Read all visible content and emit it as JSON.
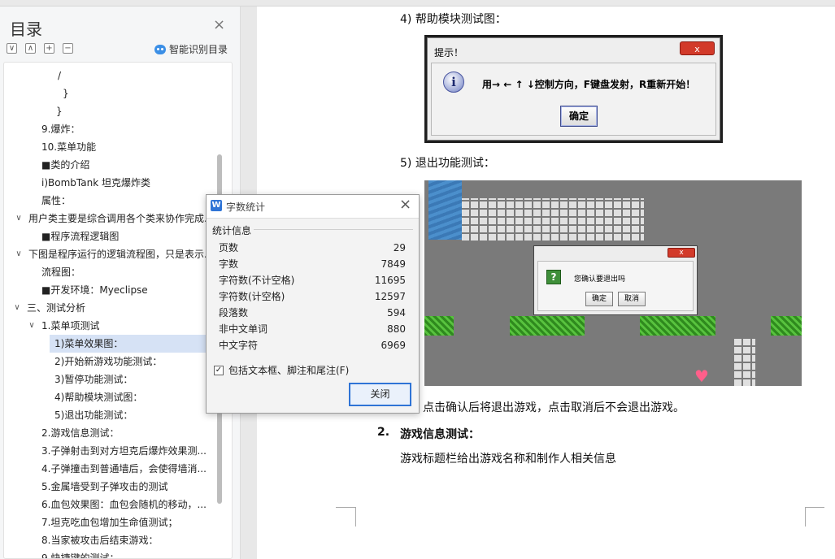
{
  "sidebar": {
    "title": "目录",
    "close_glyph": "×",
    "tools": [
      "∨",
      "∧",
      "+",
      "−"
    ],
    "smart_label": "智能识别目录",
    "items": [
      {
        "text": "/",
        "indent": 66,
        "caret": ""
      },
      {
        "text": "}",
        "indent": 72,
        "caret": ""
      },
      {
        "text": "}",
        "indent": 64,
        "caret": ""
      },
      {
        "text": "9.爆炸：",
        "indent": 46,
        "caret": ""
      },
      {
        "text": "10.菜单功能",
        "indent": 46,
        "caret": ""
      },
      {
        "text": "■类的介绍",
        "indent": 46,
        "caret": ""
      },
      {
        "text": "i)BombTank     坦克爆炸类",
        "indent": 46,
        "caret": ""
      },
      {
        "text": "属性：",
        "indent": 46,
        "caret": ""
      },
      {
        "text": "用户类主要是综合调用各个类来协作完成...",
        "indent": 30,
        "caret": "∨"
      },
      {
        "text": "■程序流程逻辑图",
        "indent": 46,
        "caret": ""
      },
      {
        "text": "下图是程序运行的逻辑流程图，只是表示...",
        "indent": 30,
        "caret": "∨"
      },
      {
        "text": "流程图：",
        "indent": 46,
        "caret": ""
      },
      {
        "text": "■开发环境：Myeclipse",
        "indent": 46,
        "caret": ""
      },
      {
        "text": "三、测试分析",
        "indent": 28,
        "caret": "∨"
      },
      {
        "text": "1.菜单项测试",
        "indent": 46,
        "caret": "∨"
      },
      {
        "text": "1)菜单效果图：",
        "indent": 62,
        "caret": "",
        "selected": true
      },
      {
        "text": "2)开始新游戏功能测试：",
        "indent": 62,
        "caret": ""
      },
      {
        "text": "3)暂停功能测试：",
        "indent": 62,
        "caret": ""
      },
      {
        "text": "4)帮助模块测试图：",
        "indent": 62,
        "caret": ""
      },
      {
        "text": "5)退出功能测试：",
        "indent": 62,
        "caret": ""
      },
      {
        "text": "2.游戏信息测试：",
        "indent": 46,
        "caret": ""
      },
      {
        "text": "3.子弹射击到对方坦克后爆炸效果测...",
        "indent": 46,
        "caret": ""
      },
      {
        "text": "4.子弹撞击到普通墙后，会使得墙消...",
        "indent": 46,
        "caret": ""
      },
      {
        "text": "5.金属墙受到子弹攻击的测试",
        "indent": 46,
        "caret": ""
      },
      {
        "text": "6.血包效果图：血包会随机的移动，...",
        "indent": 46,
        "caret": ""
      },
      {
        "text": "7.坦克吃血包增加生命值测试；",
        "indent": 46,
        "caret": ""
      },
      {
        "text": "8.当家被攻击后结束游戏：",
        "indent": 46,
        "caret": ""
      },
      {
        "text": "9.快捷键的测试：",
        "indent": 46,
        "caret": ""
      }
    ]
  },
  "document": {
    "heading4": "4)   帮助模块测试图：",
    "heading5": "5)   退出功能测试：",
    "after_image_text": "点击确认后将退出游戏，点击取消后不会退出游戏。",
    "section2_num": "2.",
    "section2_title": "游戏信息测试：",
    "section2_body": "游戏标题栏给出游戏名称和制作人相关信息"
  },
  "help_dialog": {
    "title": "提示！",
    "close_glyph": "x",
    "info_glyph": "i",
    "message": "用→ ← ↑ ↓控制方向，F键盘发射，R重新开始！",
    "ok_label": "确定"
  },
  "exit_dialog": {
    "close_glyph": "x",
    "question_glyph": "?",
    "message": "您确认要退出吗",
    "ok_label": "确定",
    "cancel_label": "取消"
  },
  "heart_glyph": "♥",
  "word_count": {
    "logo": "W",
    "title": "字数统计",
    "close_glyph": "×",
    "section": "统计信息",
    "rows": [
      {
        "label": "页数",
        "value": "29"
      },
      {
        "label": "字数",
        "value": "7849"
      },
      {
        "label": "字符数(不计空格)",
        "value": "11695"
      },
      {
        "label": "字符数(计空格)",
        "value": "12597"
      },
      {
        "label": "段落数",
        "value": "594"
      },
      {
        "label": "非中文单词",
        "value": "880"
      },
      {
        "label": "中文字符",
        "value": "6969"
      }
    ],
    "checkbox_label": "包括文本框、脚注和尾注(F)",
    "checkbox_checked": true,
    "check_glyph": "✓",
    "close_button": "关闭"
  },
  "colors": {
    "accent": "#2f74d6",
    "selection": "#d6e2f5",
    "grass": "#3e9e2c",
    "water": "#4b8fcc"
  }
}
